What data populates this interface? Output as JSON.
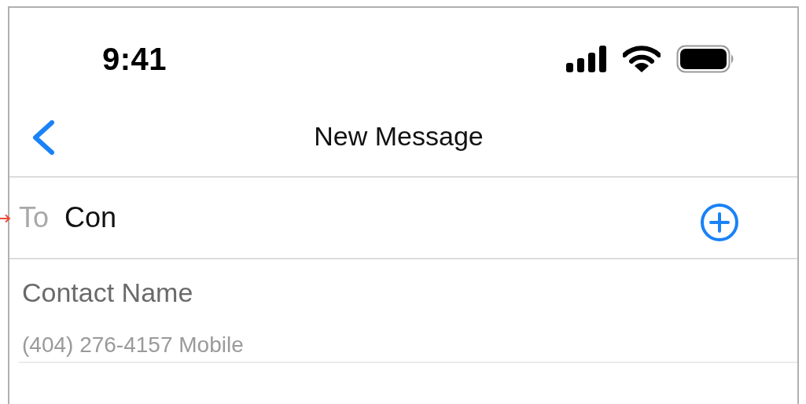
{
  "status_bar": {
    "time": "9:41"
  },
  "nav_bar": {
    "title": "New Message"
  },
  "to_field": {
    "label": "To",
    "value": "Con"
  },
  "suggestions": [
    {
      "name": "Contact Name",
      "detail": "(404) 276-4157 Mobile"
    }
  ]
}
